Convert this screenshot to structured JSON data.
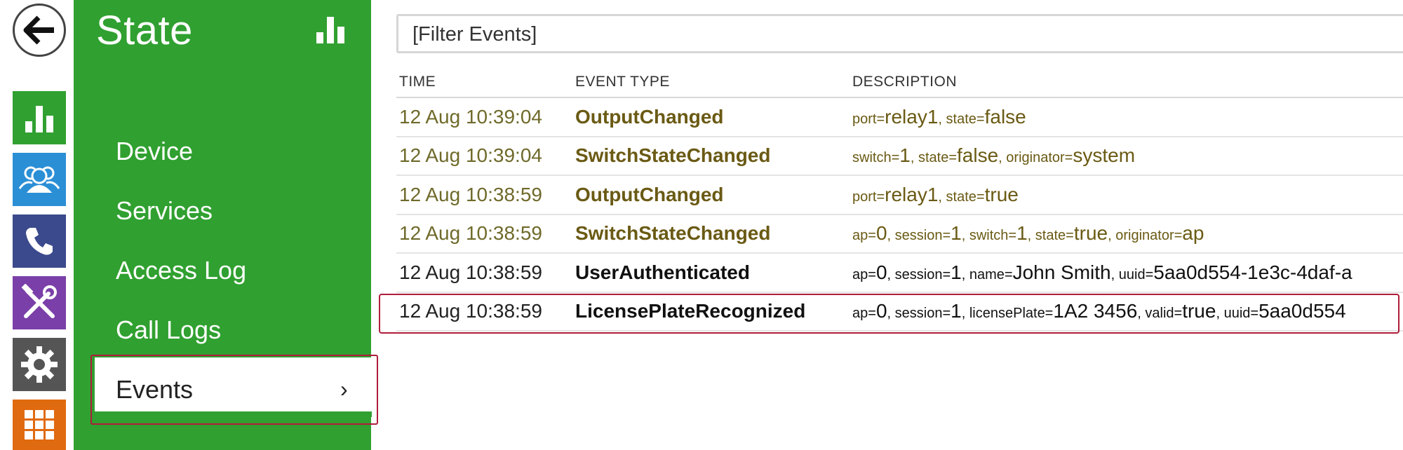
{
  "menu": {
    "title": "State",
    "items": [
      {
        "label": "Device"
      },
      {
        "label": "Services"
      },
      {
        "label": "Access Log"
      },
      {
        "label": "Call Logs"
      }
    ],
    "active_item": {
      "label": "Events",
      "chevron": "›"
    }
  },
  "rail": {
    "icons": [
      "back-arrow-icon",
      "state-chart-icon",
      "directory-users-icon",
      "phone-icon",
      "hardware-tools-icon",
      "settings-gear-icon",
      "apps-grid-icon"
    ],
    "colors": {
      "state": "#30a030",
      "directory": "#2b8fd6",
      "phone": "#3a4a8c",
      "hardware": "#7a3fa8",
      "settings": "#555555",
      "apps": "#e06a10"
    }
  },
  "filter": {
    "placeholder": "[Filter Events]"
  },
  "table": {
    "headers": {
      "time": "TIME",
      "type": "EVENT TYPE",
      "desc": "DESCRIPTION"
    },
    "rows": [
      {
        "time": "12 Aug 10:39:04",
        "type": "OutputChanged",
        "desc": [
          [
            "port=",
            "relay1"
          ],
          [
            "state=",
            "false"
          ]
        ]
      },
      {
        "time": "12 Aug 10:39:04",
        "type": "SwitchStateChanged",
        "desc": [
          [
            "switch=",
            "1"
          ],
          [
            "state=",
            "false"
          ],
          [
            "originator=",
            "system"
          ]
        ]
      },
      {
        "time": "12 Aug 10:38:59",
        "type": "OutputChanged",
        "desc": [
          [
            "port=",
            "relay1"
          ],
          [
            "state=",
            "true"
          ]
        ]
      },
      {
        "time": "12 Aug 10:38:59",
        "type": "SwitchStateChanged",
        "desc": [
          [
            "ap=",
            "0"
          ],
          [
            "session=",
            "1"
          ],
          [
            "switch=",
            "1"
          ],
          [
            "state=",
            "true"
          ],
          [
            "originator=",
            "ap"
          ]
        ]
      },
      {
        "time": "12 Aug 10:38:59",
        "type": "UserAuthenticated",
        "desc": [
          [
            "ap=",
            "0"
          ],
          [
            "session=",
            "1"
          ],
          [
            "name=",
            "John Smith"
          ],
          [
            "uuid=",
            "5aa0d554-1e3c-4daf-a"
          ]
        ]
      },
      {
        "time": "12 Aug 10:38:59",
        "type": "LicensePlateRecognized",
        "desc": [
          [
            "ap=",
            "0"
          ],
          [
            "session=",
            "1"
          ],
          [
            "licensePlate=",
            "1A2 3456"
          ],
          [
            "valid=",
            "true"
          ],
          [
            "uuid=",
            "5aa0d554"
          ]
        ]
      }
    ]
  }
}
